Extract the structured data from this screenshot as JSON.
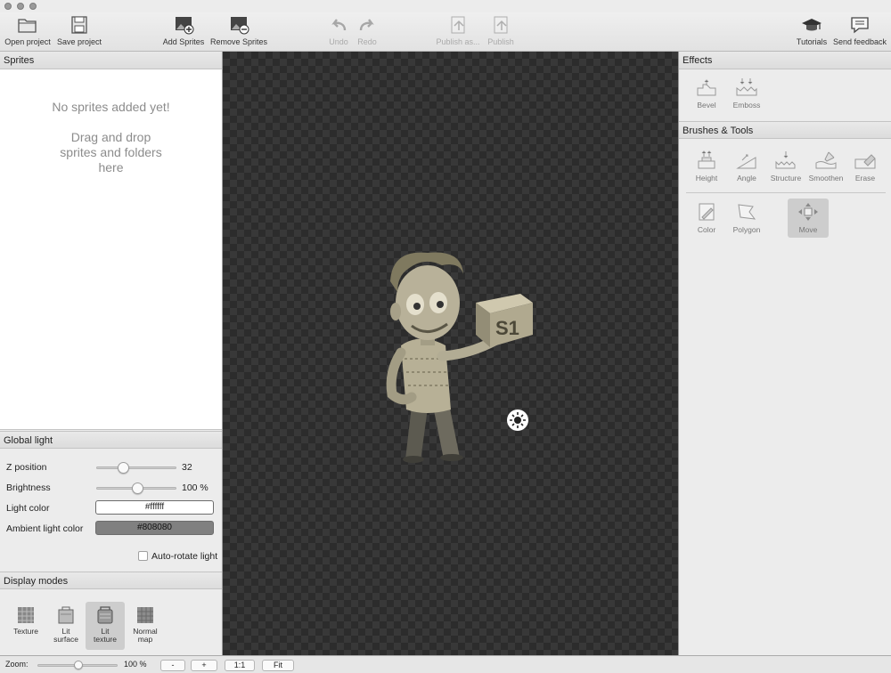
{
  "toolbar": {
    "open_project": "Open project",
    "save_project": "Save project",
    "add_sprites": "Add Sprites",
    "remove_sprites": "Remove Sprites",
    "undo": "Undo",
    "redo": "Redo",
    "publish_as": "Publish as...",
    "publish": "Publish",
    "tutorials": "Tutorials",
    "send_feedback": "Send feedback"
  },
  "sprites": {
    "title": "Sprites",
    "empty_line1": "No sprites added yet!",
    "empty_line2": "Drag and drop",
    "empty_line3": "sprites and folders",
    "empty_line4": "here"
  },
  "global_light": {
    "title": "Global light",
    "z_position_label": "Z position",
    "z_position_value": "32",
    "z_position_fraction": 0.33,
    "brightness_label": "Brightness",
    "brightness_value": "100 %",
    "brightness_fraction": 0.5,
    "light_color_label": "Light color",
    "light_color_value": "#ffffff",
    "ambient_label": "Ambient light color",
    "ambient_value": "#808080",
    "auto_rotate_label": "Auto-rotate light",
    "auto_rotate_checked": false
  },
  "display_modes": {
    "title": "Display modes",
    "texture": "Texture",
    "lit_surface_1": "Lit",
    "lit_surface_2": "surface",
    "lit_texture_1": "Lit",
    "lit_texture_2": "texture",
    "normal_map_1": "Normal",
    "normal_map_2": "map",
    "active": "lit-texture"
  },
  "effects": {
    "title": "Effects",
    "bevel": "Bevel",
    "emboss": "Emboss"
  },
  "brushes": {
    "title": "Brushes & Tools",
    "height": "Height",
    "angle": "Angle",
    "structure": "Structure",
    "smoothen": "Smoothen",
    "erase": "Erase",
    "color": "Color",
    "polygon": "Polygon",
    "move": "Move",
    "active": "move"
  },
  "statusbar": {
    "zoom_label": "Zoom:",
    "zoom_value": "100 %",
    "zoom_out": "-",
    "zoom_in": "+",
    "one_to_one": "1:1",
    "fit": "Fit"
  },
  "sprite_box_text": "S1",
  "colors": {
    "canvas_dark": "#2c2c2c",
    "canvas_light": "#383838",
    "ambient": "#808080",
    "active_button": "#cdcdcd"
  }
}
